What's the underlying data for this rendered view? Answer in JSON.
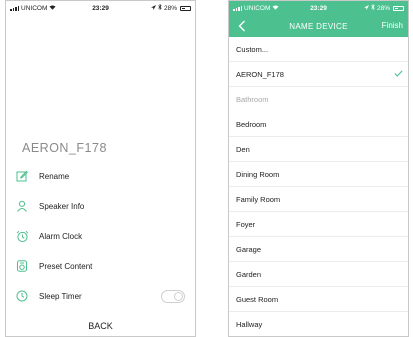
{
  "left_phone": {
    "status": {
      "carrier": "UNICOM",
      "time": "23:29",
      "battery": "28%"
    },
    "device_name": "AERON_F178",
    "menu": [
      {
        "label": "Rename",
        "icon": "pencil-icon"
      },
      {
        "label": "Speaker Info",
        "icon": "person-icon"
      },
      {
        "label": "Alarm Clock",
        "icon": "alarm-clock-icon"
      },
      {
        "label": "Preset Content",
        "icon": "preset-icon"
      },
      {
        "label": "Sleep Timer",
        "icon": "clock-icon"
      }
    ],
    "sleep_timer_on": false,
    "back_label": "BACK"
  },
  "right_phone": {
    "status": {
      "carrier": "UNICOM",
      "time": "23:29",
      "battery": "28%"
    },
    "title": "NAME DEVICE",
    "finish_label": "Finish",
    "options": [
      {
        "label": "Custom...",
        "type": "option"
      },
      {
        "label": "AERON_F178",
        "type": "option",
        "selected": true
      },
      {
        "label": "Bathroom",
        "type": "header"
      },
      {
        "label": "Bedroom",
        "type": "option"
      },
      {
        "label": "Den",
        "type": "option"
      },
      {
        "label": "Dining Room",
        "type": "option"
      },
      {
        "label": "Family Room",
        "type": "option"
      },
      {
        "label": "Foyer",
        "type": "option"
      },
      {
        "label": "Garage",
        "type": "option"
      },
      {
        "label": "Garden",
        "type": "option"
      },
      {
        "label": "Guest Room",
        "type": "option"
      },
      {
        "label": "Hallway",
        "type": "option"
      }
    ]
  },
  "colors": {
    "accent": "#4dc08f",
    "text": "#222222",
    "muted": "#8a8a8a"
  }
}
